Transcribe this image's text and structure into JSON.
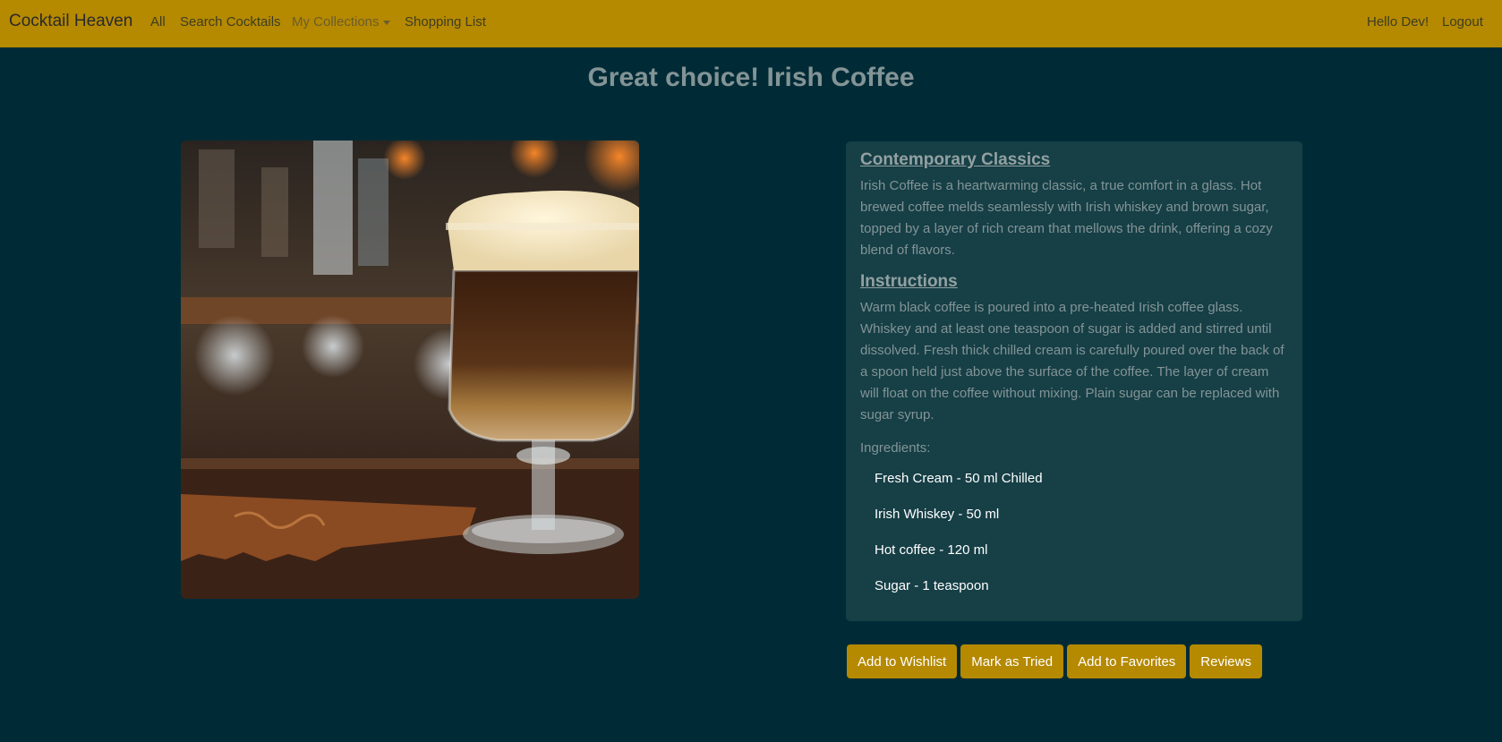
{
  "nav": {
    "brand": "Cocktail Heaven",
    "links": [
      "All",
      "Search Cocktails",
      "My Collections",
      "Shopping List"
    ],
    "greeting": "Hello Dev!",
    "logout": "Logout"
  },
  "page": {
    "title": "Great choice! Irish Coffee"
  },
  "photo": {
    "alt": "Irish Coffee"
  },
  "details": {
    "category": "Contemporary Classics",
    "description": "Irish Coffee is a heartwarming classic, a true comfort in a glass. Hot brewed coffee melds seamlessly with Irish whiskey and brown sugar, topped by a layer of rich cream that mellows the drink, offering a cozy blend of flavors.",
    "instructions_title": "Instructions",
    "instructions": "Warm black coffee is poured into a pre-heated Irish coffee glass. Whiskey and at least one teaspoon of sugar is added and stirred until dissolved. Fresh thick chilled cream is carefully poured over the back of a spoon held just above the surface of the coffee. The layer of cream will float on the coffee without mixing. Plain sugar can be replaced with sugar syrup.",
    "ingredients_label": "Ingredients:",
    "ingredients": [
      "Fresh Cream - 50 ml Chilled",
      "Irish Whiskey - 50 ml",
      "Hot coffee - 120 ml",
      "Sugar - 1 teaspoon"
    ]
  },
  "actions": {
    "wishlist": "Add to Wishlist",
    "tried": "Mark as Tried",
    "favorites": "Add to Favorites",
    "reviews": "Reviews"
  },
  "colors": {
    "background": "#002b36",
    "navbar": "#b58900",
    "card": "#163f46",
    "button": "#b58900"
  }
}
